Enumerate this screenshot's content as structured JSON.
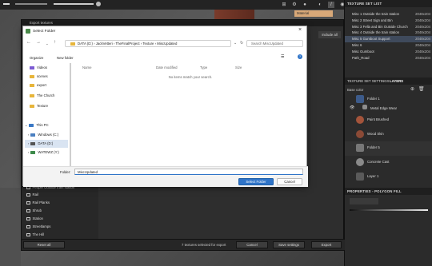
{
  "toolbar": {
    "material_label": "Material"
  },
  "texture_set_list": {
    "title": "TEXTURE SET LIST",
    "items": [
      {
        "name": "Misc 1 Outside the train station",
        "res": "2048x204",
        "selected": false
      },
      {
        "name": "Misc 2 Street Sign and Bin",
        "res": "2048x204",
        "selected": false
      },
      {
        "name": "Misc 3 Fella and Bin Outside Church",
        "res": "2048x204",
        "selected": false
      },
      {
        "name": "Misc 4 Outside the train station",
        "res": "2048x204",
        "selected": false
      },
      {
        "name": "Misc 5 Gumboot Support",
        "res": "2048x204",
        "selected": true
      },
      {
        "name": "Misc 6",
        "res": "2048x204",
        "selected": false
      },
      {
        "name": "Misc Gumboot",
        "res": "2048x204",
        "selected": false
      },
      {
        "name": "Path_Road",
        "res": "2048x204",
        "selected": false
      }
    ]
  },
  "layers_panel": {
    "tab_settings": "TEXTURE SET SETTINGS",
    "tab_layers": "LAYERS",
    "blend_mode": "Base color",
    "layers": [
      {
        "name": "Folder 1",
        "color": "#9a9a9a"
      },
      {
        "name": "Metal Edge Wear",
        "color": "#8d8d8d"
      },
      {
        "name": "Paint Brushed",
        "color": "#a4543b"
      },
      {
        "name": "Wood Skin",
        "color": "#8b4a36"
      },
      {
        "name": "Folder 5",
        "color": "#777777"
      },
      {
        "name": "Concrete Cast",
        "color": "#8a8a8a"
      },
      {
        "name": "Layer 1",
        "color": "#5a5a5a"
      }
    ],
    "properties_title": "PROPERTIES - POLYGON FILL"
  },
  "export_dialog": {
    "title": "Export textures",
    "include_all": "Include all",
    "checklist": [
      "People Outside train station",
      "Rail",
      "Rail Planks",
      "Shrub",
      "Station",
      "Streetlamps",
      "The Hill"
    ],
    "reset_all": "Reset all",
    "status": "7 textures selected for export",
    "cancel": "Cancel",
    "save_settings": "Save settings",
    "export": "Export"
  },
  "select_folder": {
    "title": "Select Folder",
    "breadcrumb": "DATA (D:)  ›  JackVetteri  ›  TheFinalProject  ›  Texture  ›  MiscUpdated",
    "search_placeholder": "Search MiscUpdated",
    "organize": "Organize",
    "new_folder": "New folder",
    "columns": [
      "Name",
      "Date modified",
      "Type",
      "Size"
    ],
    "empty_message": "No items match your search.",
    "nav_folders": [
      "Videos",
      "scenes",
      "export",
      "The Church",
      "Texture"
    ],
    "nav_this_pc": "This PC",
    "nav_drives": [
      "Windows (C:)",
      "DATA (D:)",
      "WATEWZ (Y:)"
    ],
    "folder_label": "Folder:",
    "folder_value": "MiscUpdated",
    "select_btn": "Select Folder",
    "cancel_btn": "Cancel"
  }
}
